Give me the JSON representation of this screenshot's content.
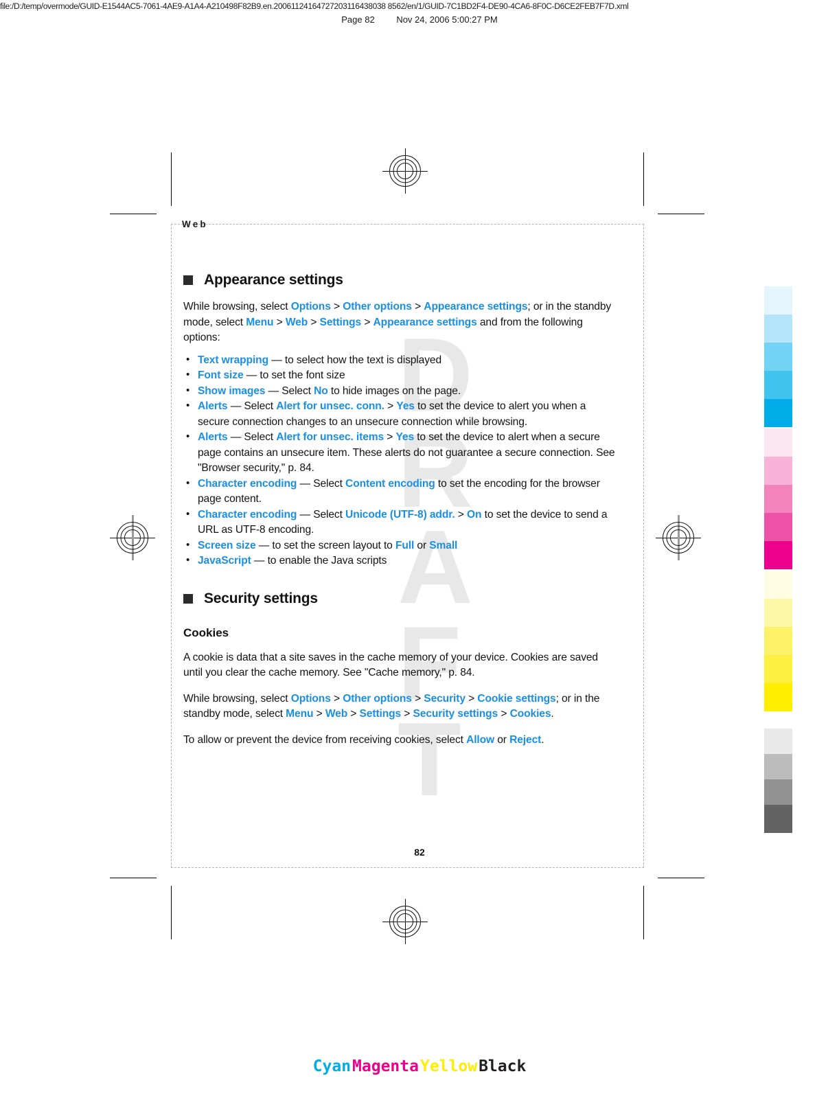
{
  "print_header": {
    "url": "file:/D:/temp/overmode/GUID-E1544AC5-7061-4AE9-A1A4-A210498F82B9.en.20061124164727203116438038 8562/en/1/GUID-7C1BD2F4-DE90-4CA6-8F0C-D6CE2FEB7F7D.xml",
    "url_display": "file:/D:/temp/overmode/GUID-E1544AC5-7061-4AE9-A1A4-A210498F82B9.en.20061124164727203116438038 8562/en/1/GUID-7C1BD2F4-DE90-4CA6-8F0C-D6CE2FEB7F7D.xml",
    "page_label": "Page 82",
    "timestamp": "Nov 24, 2006 5:00:27 PM"
  },
  "running_head": "Web",
  "watermark": "DRAFT",
  "folio": "82",
  "accent_color": "#1a8fe3",
  "sections": [
    {
      "heading": "Appearance settings",
      "intro": {
        "p1_a": "While browsing, select ",
        "p1_l1": "Options",
        "p1_b": " > ",
        "p1_l2": "Other options",
        "p1_c": " > ",
        "p1_l3": "Appearance settings",
        "p1_d": "; or in the standby mode, select ",
        "p1_l4": "Menu",
        "p1_e": " > ",
        "p1_l5": "Web",
        "p1_f": " > ",
        "p1_l6": "Settings",
        "p1_g": " > ",
        "p1_l7": "Appearance settings",
        "p1_h": " and from the following options:"
      },
      "options": [
        {
          "label": "Text wrapping",
          "dash": " — ",
          "rest_a": "to select how the text is displayed"
        },
        {
          "label": "Font size",
          "dash": " — ",
          "rest_a": "to set the font size"
        },
        {
          "label": "Show images",
          "dash": " — ",
          "rest_a": "Select ",
          "link1": "No",
          "rest_b": " to hide images on the page."
        },
        {
          "label": "Alerts",
          "dash": " — ",
          "rest_a": "Select ",
          "link1": "Alert for unsec. conn.",
          "rest_b": " > ",
          "link2": "Yes",
          "rest_c": " to set the device to alert you when a secure connection changes to an unsecure connection while browsing."
        },
        {
          "label": "Alerts",
          "dash": " — ",
          "rest_a": "Select ",
          "link1": "Alert for unsec. items",
          "rest_b": " > ",
          "link2": "Yes",
          "rest_c": " to set the device to alert when a secure page contains an unsecure item. These alerts do not guarantee a secure connection. See \"Browser security,\" p. 84."
        },
        {
          "label": "Character encoding",
          "dash": " — ",
          "rest_a": "Select ",
          "link1": "Content encoding",
          "rest_b": " to set the encoding for the browser page content."
        },
        {
          "label": "Character encoding",
          "dash": " — ",
          "rest_a": "Select ",
          "link1": "Unicode (UTF-8) addr.",
          "rest_b": " > ",
          "link2": "On",
          "rest_c": " to set the device to send a URL as UTF-8 encoding."
        },
        {
          "label": "Screen size",
          "dash": " — ",
          "rest_a": "to set the screen layout to ",
          "link1": "Full",
          "rest_b": " or ",
          "link2": "Small"
        },
        {
          "label": "JavaScript",
          "dash": " — ",
          "rest_a": "to enable the Java scripts"
        }
      ]
    },
    {
      "heading": "Security settings",
      "subheading": "Cookies",
      "p_cookie_def": "A cookie is data that a site saves in the cache memory of your device. Cookies are saved until you clear the cache memory. See \"Cache memory,\" p. 84.",
      "p_path": {
        "a": "While browsing, select ",
        "l1": "Options",
        "b": " > ",
        "l2": "Other options",
        "c": " > ",
        "l3": "Security",
        "d": " > ",
        "l4": "Cookie settings",
        "e": "; or in the standby mode, select ",
        "l5": "Menu",
        "f": " > ",
        "l6": "Web",
        "g": " > ",
        "l7": "Settings",
        "h": " > ",
        "l8": "Security settings",
        "i": " > ",
        "l9": "Cookies",
        "j": "."
      },
      "p_allow": {
        "a": "To allow or prevent the device from receiving cookies, select ",
        "l1": "Allow",
        "b": " or ",
        "l2": "Reject",
        "c": "."
      }
    }
  ],
  "color_bars": {
    "cyan": [
      "#e4f5fd",
      "#b4e5f8",
      "#72d3f4",
      "#41c3ef",
      "#00ade8"
    ],
    "magenta": [
      "#fce6f1",
      "#f9b3d8",
      "#f383bd",
      "#ee52a8",
      "#ec008c"
    ],
    "yellow": [
      "#fefde4",
      "#fdf7a8",
      "#fcf268",
      "#fdf040",
      "#ffee00"
    ],
    "black": [
      "#e9e9e9",
      "#bcbcbc",
      "#919191",
      "#636363",
      "#231f20"
    ]
  },
  "color_names": [
    {
      "label": "Cyan",
      "color": "#00ade8"
    },
    {
      "label": "Magenta",
      "color": "#ec008c"
    },
    {
      "label": "Yellow",
      "color": "#ffee00"
    },
    {
      "label": "Black",
      "color": "#231f20"
    }
  ]
}
